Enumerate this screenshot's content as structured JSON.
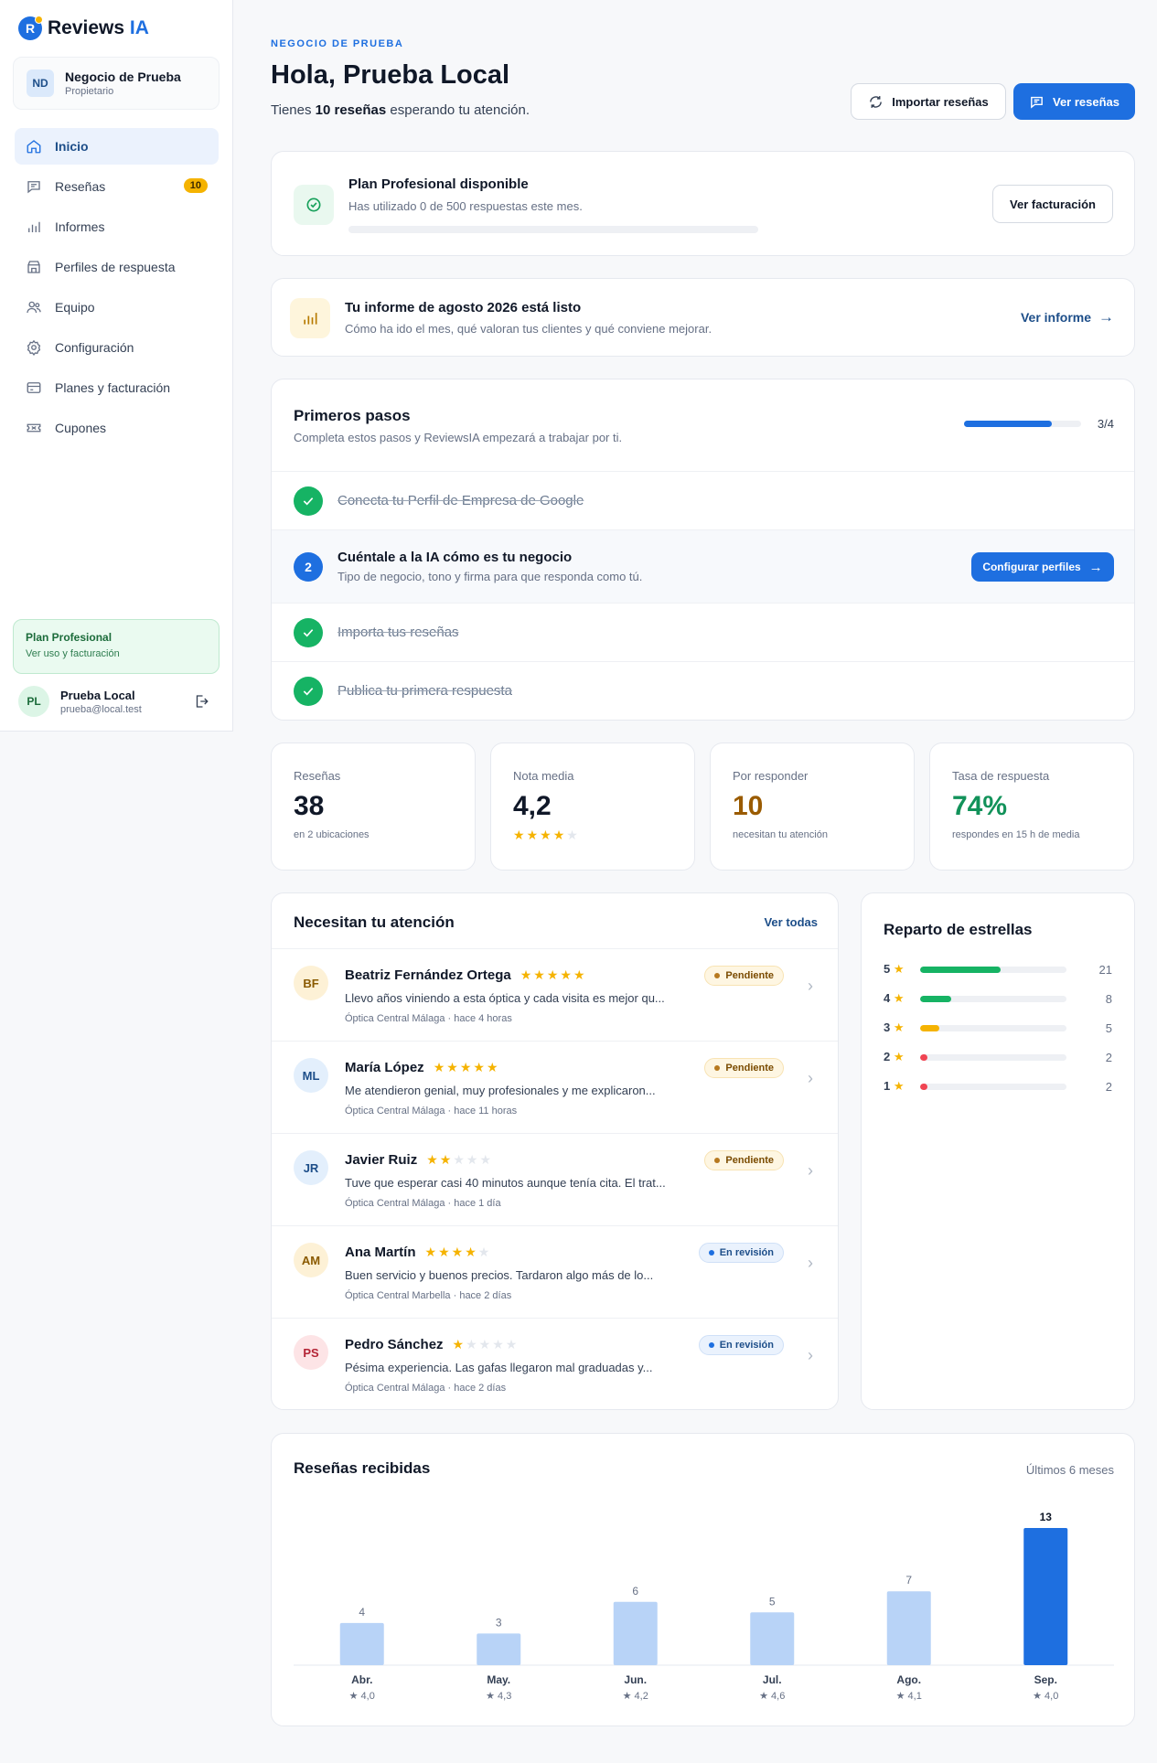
{
  "app": {
    "logo_letter": "R",
    "logo_main": "Reviews",
    "logo_accent": "IA"
  },
  "business": {
    "initials": "ND",
    "name": "Negocio de Prueba",
    "role": "Propietario"
  },
  "nav": [
    {
      "label": "Inicio",
      "icon": "home-icon",
      "active": true
    },
    {
      "label": "Reseñas",
      "icon": "chat-icon",
      "badge": "10"
    },
    {
      "label": "Informes",
      "icon": "bar-chart-icon"
    },
    {
      "label": "Perfiles de respuesta",
      "icon": "store-icon"
    },
    {
      "label": "Equipo",
      "icon": "users-icon"
    },
    {
      "label": "Configuración",
      "icon": "gear-icon"
    },
    {
      "label": "Planes y facturación",
      "icon": "card-icon"
    },
    {
      "label": "Cupones",
      "icon": "ticket-icon"
    }
  ],
  "sidebar_plan": {
    "title": "Plan Profesional",
    "subtitle": "Ver uso y facturación"
  },
  "user": {
    "initials": "PL",
    "name": "Prueba Local",
    "email": "prueba@local.test"
  },
  "header": {
    "eyebrow": "NEGOCIO DE PRUEBA",
    "greeting": "Hola, Prueba Local",
    "sub_pre": "Tienes ",
    "sub_bold": "10 reseñas",
    "sub_post": " esperando tu atención.",
    "import_label": "Importar reseñas",
    "view_label": "Ver reseñas"
  },
  "plan_card": {
    "title": "Plan Profesional disponible",
    "subtitle": "Has utilizado 0 de 500 respuestas este mes.",
    "usage_fraction": 0,
    "button": "Ver facturación"
  },
  "report_card": {
    "title": "Tu informe de agosto 2026 está listo",
    "subtitle": "Cómo ha ido el mes, qué valoran tus clientes y qué conviene mejorar.",
    "link": "Ver informe"
  },
  "steps": {
    "title": "Primeros pasos",
    "subtitle": "Completa estos pasos y ReviewsIA empezará a trabajar por ti.",
    "progress_text": "3/4",
    "progress_fraction": 0.75,
    "items": [
      {
        "label": "Conecta tu Perfil de Empresa de Google",
        "done": true
      },
      {
        "label": "Cuéntale a la IA cómo es tu negocio",
        "done": false,
        "number": "2",
        "desc": "Tipo de negocio, tono y firma para que responda como tú.",
        "button": "Configurar perfiles"
      },
      {
        "label": "Importa tus reseñas",
        "done": true
      },
      {
        "label": "Publica tu primera respuesta",
        "done": true
      }
    ]
  },
  "stats": [
    {
      "label": "Reseñas",
      "value": "38",
      "foot": "en 2 ubicaciones",
      "color": "#101828"
    },
    {
      "label": "Nota media",
      "value": "4,2",
      "stars": 4,
      "color": "#101828"
    },
    {
      "label": "Por responder",
      "value": "10",
      "foot": "necesitan tu atención",
      "color": "#9a5b00"
    },
    {
      "label": "Tasa de respuesta",
      "value": "74%",
      "foot": "respondes en 15 h de media",
      "color": "#12925a"
    }
  ],
  "attention": {
    "title": "Necesitan tu atención",
    "link": "Ver todas",
    "reviews": [
      {
        "initials": "BF",
        "name": "Beatriz Fernández Ortega",
        "stars": 5,
        "text": "Llevo años viniendo a esta óptica y cada visita es mejor qu...",
        "meta": "Óptica Central Málaga · hace 4 horas",
        "status": "Pendiente",
        "kind": "pend",
        "bg": "#fdf1d6",
        "fg": "#8a5a00"
      },
      {
        "initials": "ML",
        "name": "María López",
        "stars": 5,
        "text": "Me atendieron genial, muy profesionales y me explicaron...",
        "meta": "Óptica Central Málaga · hace 11 horas",
        "status": "Pendiente",
        "kind": "pend",
        "bg": "#e3effc",
        "fg": "#1d4e89"
      },
      {
        "initials": "JR",
        "name": "Javier Ruiz",
        "stars": 2,
        "text": "Tuve que esperar casi 40 minutos aunque tenía cita. El trat...",
        "meta": "Óptica Central Málaga · hace 1 día",
        "status": "Pendiente",
        "kind": "pend",
        "bg": "#e3effc",
        "fg": "#1d4e89"
      },
      {
        "initials": "AM",
        "name": "Ana Martín",
        "stars": 4,
        "text": "Buen servicio y buenos precios. Tardaron algo más de lo...",
        "meta": "Óptica Central Marbella · hace 2 días",
        "status": "En revisión",
        "kind": "revw",
        "bg": "#fdf1d6",
        "fg": "#8a5a00"
      },
      {
        "initials": "PS",
        "name": "Pedro Sánchez",
        "stars": 1,
        "text": "Pésima experiencia. Las gafas llegaron mal graduadas y...",
        "meta": "Óptica Central Málaga · hace 2 días",
        "status": "En revisión",
        "kind": "revw",
        "bg": "#fde4e6",
        "fg": "#b42335"
      }
    ]
  },
  "distribution": {
    "title": "Reparto de estrellas",
    "max": 21,
    "rows": [
      {
        "label": "5",
        "count": 21,
        "color": "#16b364"
      },
      {
        "label": "4",
        "count": 8,
        "color": "#16b364"
      },
      {
        "label": "3",
        "count": 5,
        "color": "#f5b301"
      },
      {
        "label": "2",
        "count": 2,
        "color": "#f04452"
      },
      {
        "label": "1",
        "count": 2,
        "color": "#f04452"
      }
    ]
  },
  "chart_card": {
    "title": "Reseñas recibidas",
    "range": "Últimos 6 meses"
  },
  "chart_data": {
    "type": "bar",
    "categories": [
      "Abr.",
      "May.",
      "Jun.",
      "Jul.",
      "Ago.",
      "Sep."
    ],
    "values": [
      4,
      3,
      6,
      5,
      7,
      13
    ],
    "ratings": [
      "★ 4,0",
      "★ 4,3",
      "★ 4,2",
      "★ 4,6",
      "★ 4,1",
      "★ 4,0"
    ],
    "highlight_index": 5,
    "colors": {
      "normal": "#b8d3f7",
      "highlight": "#1e6fe0"
    },
    "ylim": [
      0,
      13
    ]
  }
}
